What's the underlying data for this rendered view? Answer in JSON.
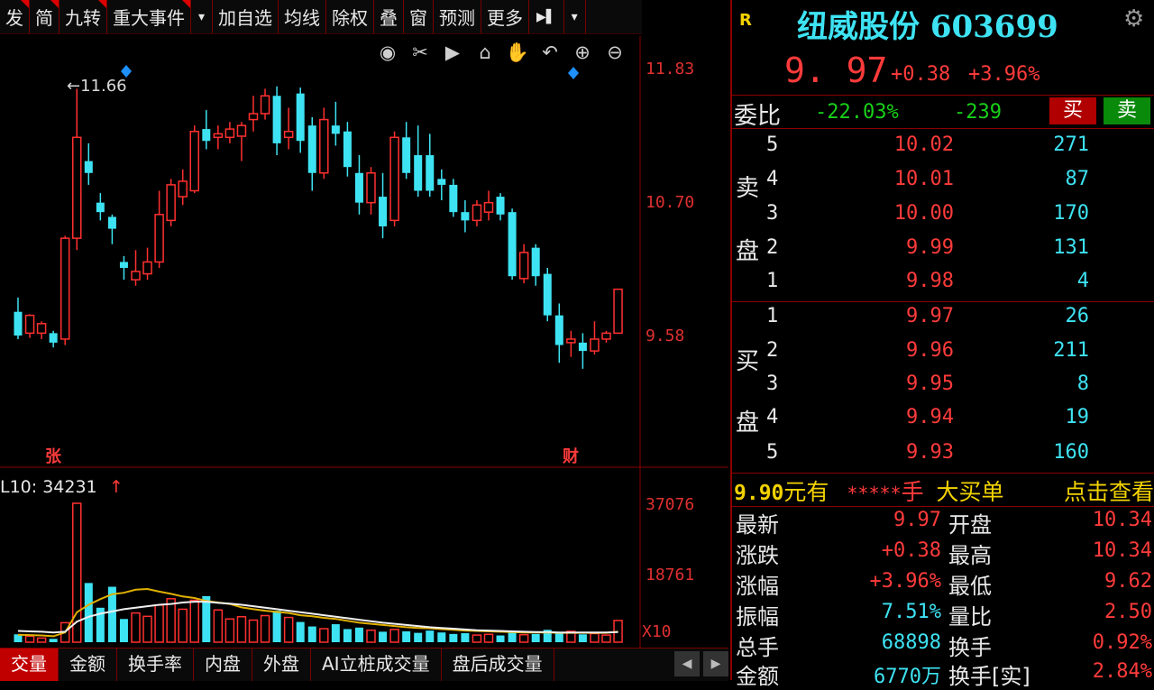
{
  "toolbar": {
    "items": [
      "发",
      "简",
      "九转",
      "重大事件",
      "▾",
      "加自选",
      "均线",
      "除权",
      "叠",
      "窗",
      "预测",
      "更多",
      "▶▌",
      "▾"
    ]
  },
  "chart_tools": [
    "eye-icon",
    "scissors-icon",
    "play-icon",
    "lock-icon",
    "hand-icon",
    "undo-icon",
    "zoom-in-icon",
    "zoom-out-icon"
  ],
  "price_axis": [
    "11.83",
    "10.70",
    "9.58"
  ],
  "max_marker": "←11.66",
  "markers": {
    "zhang": "张",
    "cai": "财"
  },
  "volume": {
    "label": "L10: 34231",
    "arrow": "↑",
    "axis": [
      "37076",
      "18761"
    ],
    "unit": "X10"
  },
  "tabs": [
    "交量",
    "金额",
    "换手率",
    "内盘",
    "外盘",
    "AI立桩成交量",
    "盘后成交量"
  ],
  "tab_nav": [
    "◀",
    "▶"
  ],
  "stock": {
    "flag": "R",
    "name": "纽威股份 603699",
    "price": "9. 97",
    "change": "+0.38",
    "change_pct": "+3.96%"
  },
  "weibi": {
    "label": "委比",
    "ratio": "-22.03%",
    "diff": "-239",
    "buy": "买",
    "sell": "卖"
  },
  "sell_side": {
    "label1": "卖",
    "label2": "盘",
    "rows": [
      {
        "level": "5",
        "price": "10.02",
        "vol": "271"
      },
      {
        "level": "4",
        "price": "10.01",
        "vol": "87"
      },
      {
        "level": "3",
        "price": "10.00",
        "vol": "170"
      },
      {
        "level": "2",
        "price": "9.99",
        "vol": "131"
      },
      {
        "level": "1",
        "price": "9.98",
        "vol": "4"
      }
    ]
  },
  "buy_side": {
    "label1": "买",
    "label2": "盘",
    "rows": [
      {
        "level": "1",
        "price": "9.97",
        "vol": "26"
      },
      {
        "level": "2",
        "price": "9.96",
        "vol": "211"
      },
      {
        "level": "3",
        "price": "9.95",
        "vol": "8"
      },
      {
        "level": "4",
        "price": "9.94",
        "vol": "19"
      },
      {
        "level": "5",
        "price": "9.93",
        "vol": "160"
      }
    ]
  },
  "big_order": {
    "price": "9.90",
    "text1": "元有",
    "stars": "*****",
    "unit": "手",
    "text2": "大买单",
    "link": "点击查看"
  },
  "stats": [
    {
      "l1": "最新",
      "v1": "9.97",
      "l2": "开盘",
      "v2": "10.34"
    },
    {
      "l1": "涨跌",
      "v1": "+0.38",
      "l2": "最高",
      "v2": "10.34"
    },
    {
      "l1": "涨幅",
      "v1": "+3.96%",
      "l2": "最低",
      "v2": "9.62"
    },
    {
      "l1": "振幅",
      "v1": "7.51%",
      "l2": "量比",
      "v2": "2.50"
    },
    {
      "l1": "总手",
      "v1": "68898",
      "l2": "换手",
      "v2": "0.92%"
    },
    {
      "l1": "金额",
      "v1": "6770万",
      "l2": "换手[实]",
      "v2": "2.84%"
    }
  ],
  "chart_data": {
    "type": "candlestick",
    "price_axis_ticks": [
      11.83,
      10.7,
      9.58
    ],
    "volume_axis_ticks": [
      37076,
      18761
    ],
    "candles": [
      {
        "o": 9.78,
        "c": 9.58,
        "h": 9.9,
        "l": 9.55
      },
      {
        "o": 9.6,
        "c": 9.75,
        "h": 9.76,
        "l": 9.56
      },
      {
        "o": 9.6,
        "c": 9.68,
        "h": 9.7,
        "l": 9.55
      },
      {
        "o": 9.6,
        "c": 9.52,
        "h": 9.62,
        "l": 9.48
      },
      {
        "o": 9.55,
        "c": 10.4,
        "h": 10.42,
        "l": 9.5
      },
      {
        "o": 10.4,
        "c": 11.25,
        "h": 11.66,
        "l": 10.3
      },
      {
        "o": 11.05,
        "c": 10.95,
        "h": 11.2,
        "l": 10.85
      },
      {
        "o": 10.7,
        "c": 10.62,
        "h": 10.78,
        "l": 10.55
      },
      {
        "o": 10.58,
        "c": 10.48,
        "h": 10.6,
        "l": 10.35
      },
      {
        "o": 10.2,
        "c": 10.15,
        "h": 10.25,
        "l": 10.05
      },
      {
        "o": 10.05,
        "c": 10.12,
        "h": 10.3,
        "l": 10.0
      },
      {
        "o": 10.1,
        "c": 10.2,
        "h": 10.32,
        "l": 10.05
      },
      {
        "o": 10.2,
        "c": 10.6,
        "h": 10.8,
        "l": 10.15
      },
      {
        "o": 10.55,
        "c": 10.85,
        "h": 10.9,
        "l": 10.5
      },
      {
        "o": 10.75,
        "c": 10.88,
        "h": 10.98,
        "l": 10.68
      },
      {
        "o": 10.8,
        "c": 11.3,
        "h": 11.35,
        "l": 10.78
      },
      {
        "o": 11.32,
        "c": 11.22,
        "h": 11.48,
        "l": 11.15
      },
      {
        "o": 11.25,
        "c": 11.28,
        "h": 11.35,
        "l": 11.15
      },
      {
        "o": 11.25,
        "c": 11.32,
        "h": 11.38,
        "l": 11.2
      },
      {
        "o": 11.26,
        "c": 11.35,
        "h": 11.38,
        "l": 11.05
      },
      {
        "o": 11.4,
        "c": 11.45,
        "h": 11.6,
        "l": 11.3
      },
      {
        "o": 11.45,
        "c": 11.6,
        "h": 11.66,
        "l": 11.4
      },
      {
        "o": 11.6,
        "c": 11.2,
        "h": 11.68,
        "l": 11.1
      },
      {
        "o": 11.25,
        "c": 11.3,
        "h": 11.5,
        "l": 11.15
      },
      {
        "o": 11.62,
        "c": 11.22,
        "h": 11.67,
        "l": 11.12
      },
      {
        "o": 11.35,
        "c": 10.95,
        "h": 11.42,
        "l": 10.8
      },
      {
        "o": 10.95,
        "c": 11.4,
        "h": 11.5,
        "l": 10.9
      },
      {
        "o": 11.35,
        "c": 11.28,
        "h": 11.55,
        "l": 11.18
      },
      {
        "o": 11.3,
        "c": 11.0,
        "h": 11.38,
        "l": 10.92
      },
      {
        "o": 10.95,
        "c": 10.7,
        "h": 11.1,
        "l": 10.6
      },
      {
        "o": 10.7,
        "c": 10.95,
        "h": 11.0,
        "l": 10.6
      },
      {
        "o": 10.75,
        "c": 10.5,
        "h": 10.95,
        "l": 10.4
      },
      {
        "o": 10.55,
        "c": 11.25,
        "h": 11.3,
        "l": 10.5
      },
      {
        "o": 11.25,
        "c": 10.95,
        "h": 11.38,
        "l": 10.9
      },
      {
        "o": 11.1,
        "c": 10.8,
        "h": 11.35,
        "l": 10.75
      },
      {
        "o": 11.1,
        "c": 10.8,
        "h": 11.28,
        "l": 10.75
      },
      {
        "o": 10.9,
        "c": 10.85,
        "h": 10.98,
        "l": 10.72
      },
      {
        "o": 10.85,
        "c": 10.62,
        "h": 10.9,
        "l": 10.58
      },
      {
        "o": 10.62,
        "c": 10.55,
        "h": 10.72,
        "l": 10.45
      },
      {
        "o": 10.55,
        "c": 10.68,
        "h": 10.72,
        "l": 10.5
      },
      {
        "o": 10.62,
        "c": 10.7,
        "h": 10.8,
        "l": 10.55
      },
      {
        "o": 10.75,
        "c": 10.6,
        "h": 10.78,
        "l": 10.55
      },
      {
        "o": 10.62,
        "c": 10.08,
        "h": 10.65,
        "l": 10.05
      },
      {
        "o": 10.06,
        "c": 10.28,
        "h": 10.35,
        "l": 10.02
      },
      {
        "o": 10.32,
        "c": 10.08,
        "h": 10.35,
        "l": 10.0
      },
      {
        "o": 10.1,
        "c": 9.75,
        "h": 10.15,
        "l": 9.7
      },
      {
        "o": 9.75,
        "c": 9.5,
        "h": 9.85,
        "l": 9.35
      },
      {
        "o": 9.52,
        "c": 9.55,
        "h": 9.62,
        "l": 9.4
      },
      {
        "o": 9.52,
        "c": 9.45,
        "h": 9.6,
        "l": 9.3
      },
      {
        "o": 9.45,
        "c": 9.55,
        "h": 9.7,
        "l": 9.42
      },
      {
        "o": 9.55,
        "c": 9.6,
        "h": 9.62,
        "l": 9.52
      },
      {
        "o": 9.6,
        "c": 9.97,
        "h": 9.97,
        "l": 9.62
      }
    ],
    "volume_bars": [
      2100,
      1600,
      1100,
      900,
      5200,
      37076,
      15800,
      9200,
      14800,
      6200,
      7800,
      6900,
      9900,
      11600,
      8800,
      11200,
      12300,
      8600,
      6200,
      6800,
      5900,
      7100,
      8400,
      6600,
      5400,
      4200,
      3600,
      4800,
      3500,
      3900,
      3200,
      2800,
      3400,
      2900,
      2500,
      3100,
      2600,
      2200,
      2400,
      1900,
      2100,
      1800,
      2600,
      2000,
      2200,
      3300,
      2400,
      2900,
      2100,
      2300,
      1900,
      5800
    ],
    "ma_lines": {
      "yellow": [
        2000,
        1900,
        1800,
        1600,
        2600,
        8000,
        10000,
        11500,
        12800,
        13200,
        14000,
        14200,
        13500,
        12900,
        12200,
        11800,
        11000,
        10600,
        10200,
        9300,
        8800,
        8400,
        8100,
        7800,
        7200,
        6900,
        6500,
        6200,
        5700,
        5200,
        4900,
        4600,
        4300,
        4000,
        3800,
        3700,
        3500,
        3300,
        3100,
        3000,
        2900,
        2800,
        2700,
        2600,
        2600,
        2600,
        2500,
        2500,
        2500,
        2500,
        2500,
        2800
      ],
      "white": [
        3000,
        2900,
        2800,
        2600,
        2800,
        5500,
        6800,
        7600,
        8200,
        8800,
        9200,
        9600,
        10000,
        10200,
        10600,
        10800,
        10800,
        10500,
        10300,
        10000,
        9600,
        9200,
        8800,
        8400,
        8000,
        7600,
        7200,
        6800,
        6400,
        6000,
        5600,
        5200,
        4900,
        4600,
        4300,
        4000,
        3800,
        3600,
        3400,
        3200,
        3100,
        3000,
        2900,
        2800,
        2700,
        2700,
        2600,
        2600,
        2600,
        2600,
        2600,
        2700
      ]
    }
  }
}
